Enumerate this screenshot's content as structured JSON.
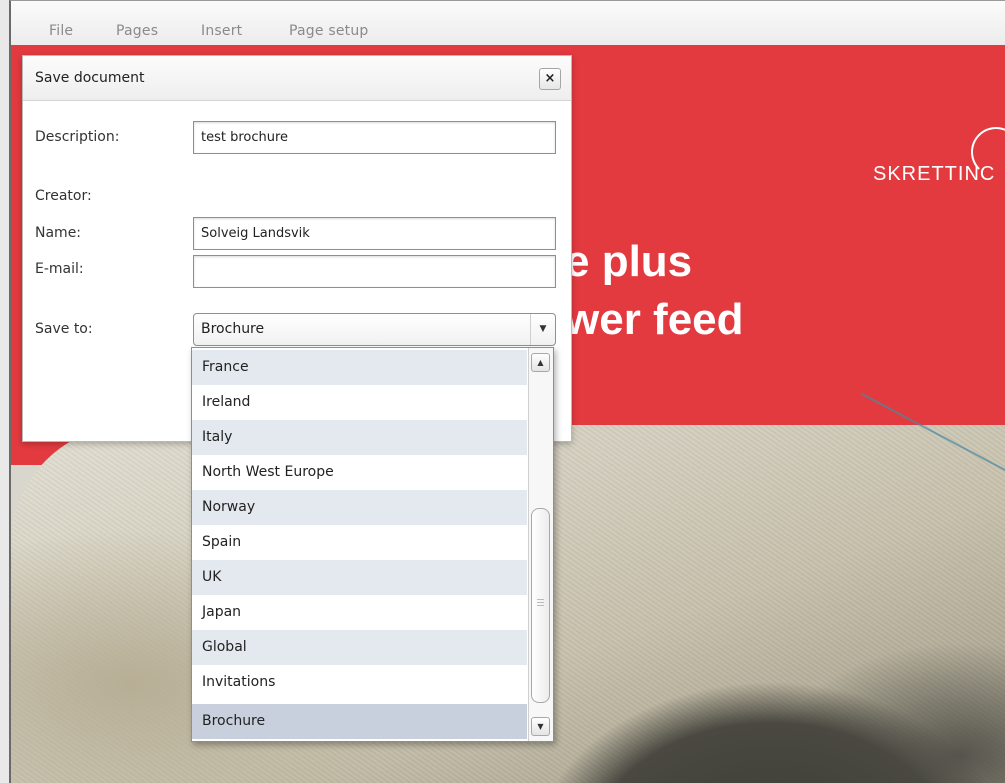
{
  "menubar": {
    "items": [
      {
        "label": "File"
      },
      {
        "label": "Pages"
      },
      {
        "label": "Insert"
      },
      {
        "label": "Page setup"
      }
    ]
  },
  "canvas": {
    "logo_text": "SKRETTINC",
    "headline_line1": "e plus",
    "headline_line2": "wer feed",
    "brand_color": "#e23a3f"
  },
  "dialog": {
    "title": "Save document",
    "close_label": "×",
    "description_label": "Description:",
    "description_value": "test brochure",
    "creator_label": "Creator:",
    "name_label": "Name:",
    "name_value": "Solveig Landsvik",
    "email_label": "E-mail:",
    "email_value": "",
    "saveto_label": "Save to:",
    "saveto_value": "Brochure"
  },
  "dropdown": {
    "options": [
      {
        "label": "France"
      },
      {
        "label": "Ireland"
      },
      {
        "label": "Italy"
      },
      {
        "label": "North West Europe"
      },
      {
        "label": "Norway"
      },
      {
        "label": "Spain"
      },
      {
        "label": "UK"
      },
      {
        "label": "Japan"
      },
      {
        "label": "Global"
      },
      {
        "label": "Invitations"
      },
      {
        "label": "Brochure"
      }
    ],
    "selected": "Brochure"
  },
  "icons": {
    "close": "close-icon",
    "select_arrow": "chevron-down-icon",
    "scroll_up": "scroll-up-icon",
    "scroll_down": "scroll-down-icon"
  }
}
